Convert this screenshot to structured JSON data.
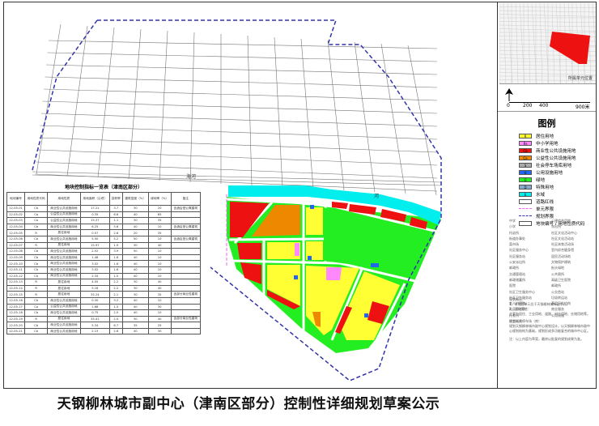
{
  "title": "天钢柳林城市副中心（津南区部分）控制性详细规划草案公示",
  "map_labels": {
    "river": "海河",
    "river2": "河"
  },
  "inset": {
    "label": "所属单元位置"
  },
  "scale": {
    "ticks": [
      "0",
      "200",
      "400",
      "900米"
    ]
  },
  "legend": {
    "title": "图例",
    "items": [
      {
        "code": "R",
        "label": "居住用地",
        "color": "#ffff33"
      },
      {
        "code": "Rs",
        "label": "中小学用地",
        "color": "#ff88ff"
      },
      {
        "code": "Cb",
        "label": "商业性公共设施用地",
        "color": "#ee1111"
      },
      {
        "code": "Ca",
        "label": "公益性公共设施用地",
        "color": "#ee8800"
      },
      {
        "code": "S",
        "label": "社会停车场库用地",
        "color": "#aaaaaa"
      },
      {
        "code": "U",
        "label": "公用设施用地",
        "color": "#2266ee"
      },
      {
        "code": "G",
        "label": "绿地",
        "color": "#22ee22"
      },
      {
        "code": "D",
        "label": "特殊用地",
        "color": "#88aacc"
      },
      {
        "code": "E",
        "label": "水域",
        "color": "#00eeee"
      },
      {
        "code": "",
        "label": "道路红线",
        "color": "#ffffff"
      },
      {
        "code": "",
        "label": "单元界限",
        "color": "#ee66ee"
      },
      {
        "code": "",
        "label": "规划界限",
        "color": "#3333aa"
      },
      {
        "code": "",
        "label": "地块编号 / 用地性质代码",
        "color": "#ffffff"
      }
    ]
  },
  "facilities": [
    "中学",
    "公建综合用地",
    "小学",
    "派出所",
    "托幼所",
    "社区文化活动中心",
    "街道办事处",
    "社区文化活动站",
    "菜市场",
    "社区体育活动场",
    "社区服务中心",
    "室内综合健身馆",
    "社区服务站",
    "居民活动场地",
    "公安派出所",
    "文物保护建筑",
    "邮政所",
    "街头绿地",
    "交通管理站",
    "公共厕所",
    "邮政储蓄所",
    "高级卫生医院",
    "医院",
    "邮政所",
    "社区卫生服务中心",
    "公交首站",
    "社区卫生服务站",
    "垃圾转运站",
    "老人护理院",
    "基层卫生机构",
    "社区养老院",
    "商业服务",
    "托老所",
    "公用设施",
    "社会公共停车场（库）",
    ""
  ],
  "notes": {
    "h1": "现状概况：",
    "p1": "1、本规划单元位于天钢柳林城市副中心。",
    "p2": "2、现状用地：",
    "p3": "主要为居住、工业用地、道路、村庄用地、仓储用地等。",
    "h2": "规划概况：",
    "p4": "规划天钢柳林城市副中心规划设计，以天钢柳林城市副中心规划结构为基础，规划形成多功能复合的城市中心区。",
    "p5": "注：以上内容为草案，最终以批复的规划成果为准。"
  },
  "table": {
    "caption": "地块控制指标一览表（津南区部分）",
    "headers": [
      "地块编号",
      "用地性质代码",
      "用地性质",
      "用地面积（公顷）",
      "容积率",
      "建筑密度（%）",
      "绿地率（%）",
      "备注"
    ],
    "rows": [
      [
        "12-05-01",
        "Cb",
        "商业性公共设施用地",
        "17.21",
        "3.7",
        "30",
        "20",
        "含酒店型公寓建筑"
      ],
      [
        "12-05-02",
        "Ca",
        "公益性公共设施用地",
        "0.35",
        "6.6",
        "40",
        "65",
        ""
      ],
      [
        "12-05-03",
        "Ca",
        "公益性公共设施用地",
        "15.37",
        "1.1",
        "30",
        "35",
        ""
      ],
      [
        "12-05-04",
        "Cb",
        "商业性公共设施用地",
        "6.25",
        "5.6",
        "40",
        "10",
        "含酒店型公寓建筑"
      ],
      [
        "12-05-05",
        "R",
        "居住用地",
        "0.57",
        "2.6",
        "20",
        "35",
        ""
      ],
      [
        "12-05-06",
        "Cb",
        "商业性公共设施用地",
        "5.50",
        "5.2",
        "50",
        "10",
        "含酒店型公寓建筑"
      ],
      [
        "12-05-07",
        "R",
        "居住用地",
        "15.97",
        "1.9",
        "30",
        "40",
        ""
      ],
      [
        "12-05-08",
        "Cb",
        "商业性公共设施用地",
        "2.52",
        "3.9",
        "50",
        "10",
        ""
      ],
      [
        "12-05-09",
        "Cb",
        "商业性公共设施用地",
        "1.48",
        "1.6",
        "40",
        "10",
        ""
      ],
      [
        "12-05-10",
        "Cb",
        "商业性公共设施用地",
        "3.52",
        "1.6",
        "40",
        "10",
        ""
      ],
      [
        "12-05-11",
        "Cb",
        "商业性公共设施用地",
        "3.02",
        "1.6",
        "40",
        "10",
        ""
      ],
      [
        "12-05-12",
        "Cb",
        "商业性公共设施用地",
        "2.34",
        "1.5",
        "40",
        "10",
        ""
      ],
      [
        "12-05-13",
        "R",
        "居住用地",
        "4.05",
        "2.2",
        "30",
        "40",
        ""
      ],
      [
        "12-05-14",
        "R",
        "居住用地",
        "5.16",
        "2.2",
        "30",
        "40",
        ""
      ],
      [
        "12-05-15",
        "R",
        "居住用地",
        "35.24",
        "2.1",
        "30",
        "35",
        "含部分商业性建筑"
      ],
      [
        "12-05-16",
        "Cb",
        "商业性公共设施用地",
        "0.30",
        "3.2",
        "40",
        "10",
        ""
      ],
      [
        "12-05-17",
        "Ca",
        "公益性公共设施用地",
        "1.68",
        "1.5",
        "40",
        "30",
        ""
      ],
      [
        "12-05-18",
        "Cb",
        "商业性公共设施用地",
        "0.75",
        "2.0",
        "40",
        "10",
        ""
      ],
      [
        "12-05-19",
        "R",
        "居住用地",
        "35.41",
        "2.0",
        "30",
        "40",
        "含部分商业性建筑"
      ],
      [
        "12-05-20",
        "Cb",
        "商业性公共设施用地",
        "5.34",
        "6.7",
        "35",
        "25",
        ""
      ],
      [
        "12-05-21",
        "Cb",
        "商业性公共设施用地",
        "2.13",
        "2.6",
        "40",
        "30",
        ""
      ]
    ]
  }
}
